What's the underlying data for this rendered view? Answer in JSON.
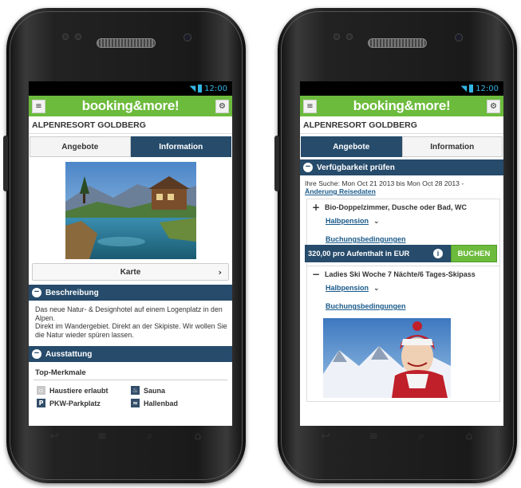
{
  "status": {
    "time": "12:00"
  },
  "app": {
    "logo": "booking&more!"
  },
  "left": {
    "hotel_name": "ALPENRESORT GOLDBERG",
    "tabs": [
      {
        "label": "Angebote",
        "active": false
      },
      {
        "label": "Information",
        "active": true
      }
    ],
    "karte_label": "Karte",
    "beschreibung": {
      "title": "Beschreibung",
      "text": "Das neue Natur- & Designhotel auf einem Logenplatz in den Alpen.\nDirekt im Wandergebiet. Direkt an der Skipiste. Wir wollen Sie die Natur wieder spüren lassen."
    },
    "ausstattung": {
      "title": "Ausstattung",
      "subtitle": "Top-Merkmale",
      "features": [
        {
          "label": "Haustiere erlaubt",
          "icon": "pet-icon"
        },
        {
          "label": "Sauna",
          "icon": "sauna-icon"
        },
        {
          "label": "PKW-Parkplatz",
          "icon": "parking-icon"
        },
        {
          "label": "Hallenbad",
          "icon": "pool-icon"
        }
      ]
    }
  },
  "right": {
    "hotel_name": "ALPENRESORT GOLDBERG",
    "tabs": [
      {
        "label": "Angebote",
        "active": true
      },
      {
        "label": "Information",
        "active": false
      }
    ],
    "availability_title": "Verfügbarkeit prüfen",
    "search_text": "Ihre Suche: Mon Oct 21 2013 bis Mon Oct 28 2013 -",
    "change_link": "Änderung Reisedaten",
    "offers": [
      {
        "sign": "+",
        "name": "Bio-Doppelzimmer, Dusche oder Bad, WC",
        "board": "Halbpension",
        "conditions": "Buchungsbedingungen",
        "price": "320,00 pro Aufenthalt in EUR",
        "book": "BUCHEN"
      },
      {
        "sign": "−",
        "name": "Ladies Ski Woche 7 Nächte/6 Tages-Skipass",
        "board": "Halbpension",
        "conditions": "Buchungsbedingungen"
      }
    ]
  }
}
